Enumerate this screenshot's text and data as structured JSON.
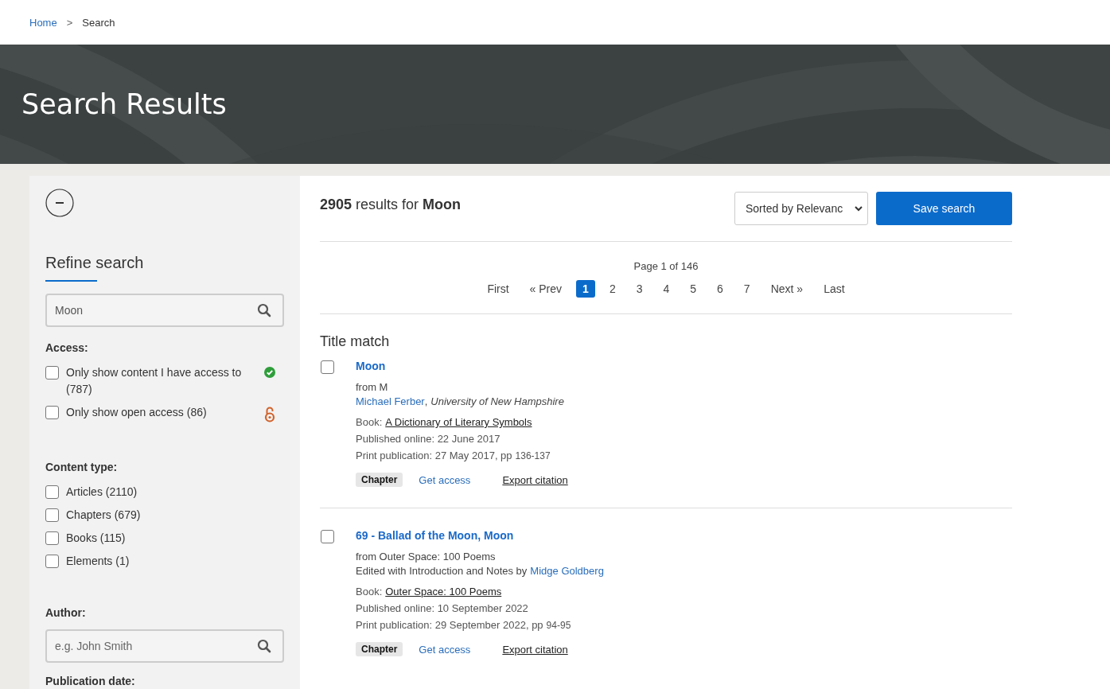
{
  "breadcrumb": {
    "separator": ">",
    "items": [
      {
        "label": "Home",
        "selected": false
      },
      {
        "label": "Search",
        "selected": true
      }
    ]
  },
  "banner": {
    "title": "Search Results"
  },
  "sidebar": {
    "title": "Refine search",
    "search": {
      "value": "Moon"
    },
    "groups": [
      {
        "kind": "checks",
        "heading": "Access:",
        "options": [
          {
            "label": "Only show content I have access to (787)",
            "checked": false,
            "kind": "access"
          },
          {
            "label": "Only show open access (86)",
            "checked": false,
            "kind": "open"
          }
        ]
      },
      {
        "kind": "checks",
        "heading": "Content type:",
        "options": [
          {
            "label": "Articles (2110)",
            "checked": false
          },
          {
            "label": "Chapters (679)",
            "checked": false
          },
          {
            "label": "Books (115)",
            "checked": false
          },
          {
            "label": "Elements (1)",
            "checked": false
          }
        ]
      },
      {
        "kind": "field",
        "heading": "Author:",
        "placeholder": "e.g. John Smith"
      },
      {
        "kind": "heading",
        "heading": "Publication date:"
      }
    ]
  },
  "summary": "**2905** results for **Moon**",
  "sort": {
    "value": "Sorted by Relevanc"
  },
  "save_button": "Save search",
  "pagination": {
    "info": "Page 1 of 146",
    "items": [
      {
        "label": "First",
        "selected": false
      },
      {
        "label": "« Prev",
        "selected": false
      },
      {
        "label": "1",
        "selected": true
      },
      {
        "label": "2",
        "selected": false
      },
      {
        "label": "3",
        "selected": false
      },
      {
        "label": "4",
        "selected": false
      },
      {
        "label": "5",
        "selected": false
      },
      {
        "label": "6",
        "selected": false
      },
      {
        "label": "7",
        "selected": false
      },
      {
        "label": "Next »",
        "selected": false
      },
      {
        "label": "Last",
        "selected": false
      }
    ]
  },
  "section_title": "Title match",
  "results": [
    {
      "checked": false,
      "title": "Moon",
      "from": "from M",
      "contributor": {
        "name": "Michael Ferber",
        "separator": ",",
        "affiliation": "University of New Hampshire"
      },
      "book_label": "Book:",
      "book": "A Dictionary of Literary Symbols",
      "published": "Published online: 22 June 2017",
      "print": "Print publication: 27 May 2017, pp",
      "pages": "136-137",
      "tag": "Chapter",
      "access_link": "Get access",
      "export_link": "Export citation"
    },
    {
      "checked": false,
      "title": "69 - Ballad of the Moon, Moon",
      "from": "from Outer Space: 100 Poems",
      "contributor": {
        "prefix": "Edited with Introduction and Notes by",
        "name": "Midge Goldberg"
      },
      "book_label": "Book:",
      "book": "Outer Space: 100 Poems",
      "published": "Published online: 10 September 2022",
      "print": "Print publication: 29 September 2022, pp",
      "pages": "94-95",
      "tag": "Chapter",
      "access_link": "Get access",
      "export_link": "Export citation"
    }
  ]
}
